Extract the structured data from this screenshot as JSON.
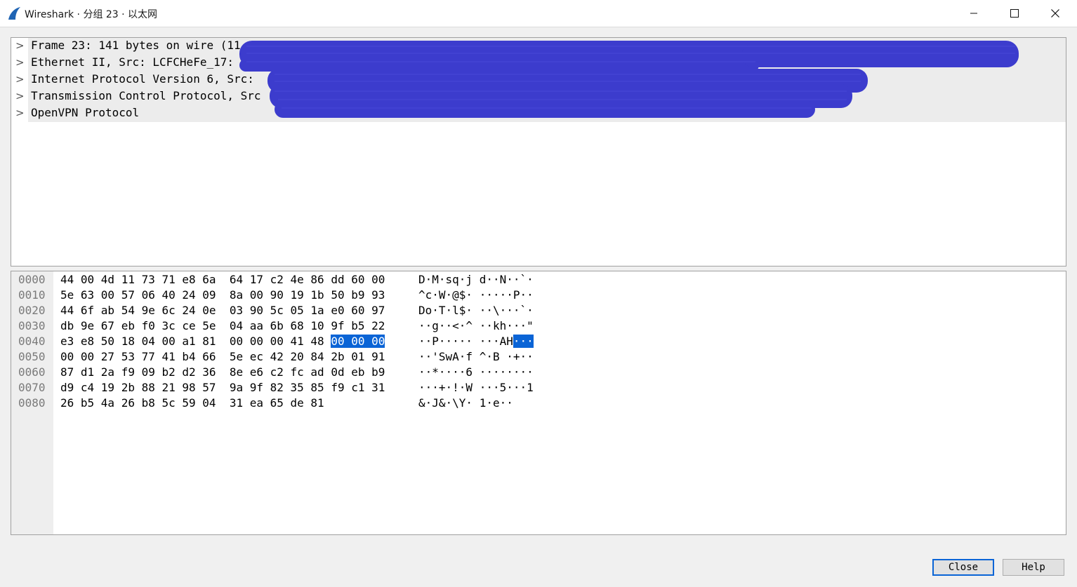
{
  "window": {
    "title": "Wireshark · 分组 23 · 以太网",
    "controls": {
      "minimize_icon": "minimize-icon",
      "maximize_icon": "maximize-icon",
      "close_icon": "close-icon"
    }
  },
  "tree": [
    {
      "label": "Frame 23: 141 bytes on wire (11",
      "expand_icon": "chevron-right-icon"
    },
    {
      "label": "Ethernet II, Src: LCFCHeFe_17:",
      "expand_icon": "chevron-right-icon"
    },
    {
      "label": "Internet Protocol Version 6, Src:",
      "expand_icon": "chevron-right-icon"
    },
    {
      "label": "Transmission Control Protocol, Src",
      "expand_icon": "chevron-right-icon"
    },
    {
      "label": "OpenVPN Protocol",
      "expand_icon": "chevron-right-icon"
    }
  ],
  "redaction_color": "#3333cc",
  "selection_color": "#0a64d6",
  "hex_rows": [
    {
      "offset": "0000",
      "bytes_pre": "44 00 4d 11 73 71 e8 6a  64 17 c2 4e 86 dd 60 00",
      "bytes_sel": "",
      "bytes_post": "",
      "ascii_pre": "D·M·sq·j d··N··`·",
      "ascii_sel": "",
      "ascii_post": ""
    },
    {
      "offset": "0010",
      "bytes_pre": "5e 63 00 57 06 40 24 09  8a 00 90 19 1b 50 b9 93",
      "bytes_sel": "",
      "bytes_post": "",
      "ascii_pre": "^c·W·@$· ·····P··",
      "ascii_sel": "",
      "ascii_post": ""
    },
    {
      "offset": "0020",
      "bytes_pre": "44 6f ab 54 9e 6c 24 0e  03 90 5c 05 1a e0 60 97",
      "bytes_sel": "",
      "bytes_post": "",
      "ascii_pre": "Do·T·l$· ··\\···`·",
      "ascii_sel": "",
      "ascii_post": ""
    },
    {
      "offset": "0030",
      "bytes_pre": "db 9e 67 eb f0 3c ce 5e  04 aa 6b 68 10 9f b5 22",
      "bytes_sel": "",
      "bytes_post": "",
      "ascii_pre": "··g··<·^ ··kh···\"",
      "ascii_sel": "",
      "ascii_post": ""
    },
    {
      "offset": "0040",
      "bytes_pre": "e3 e8 50 18 04 00 a1 81  00 00 00 41 48 ",
      "bytes_sel": "00 00 00",
      "bytes_post": "",
      "ascii_pre": "··P····· ···AH",
      "ascii_sel": "···",
      "ascii_post": ""
    },
    {
      "offset": "0050",
      "bytes_pre": "00 00 27 53 77 41 b4 66  5e ec 42 20 84 2b 01 91",
      "bytes_sel": "",
      "bytes_post": "",
      "ascii_pre": "··'SwA·f ^·B ·+··",
      "ascii_sel": "",
      "ascii_post": ""
    },
    {
      "offset": "0060",
      "bytes_pre": "87 d1 2a f9 09 b2 d2 36  8e e6 c2 fc ad 0d eb b9",
      "bytes_sel": "",
      "bytes_post": "",
      "ascii_pre": "··*····6 ········",
      "ascii_sel": "",
      "ascii_post": ""
    },
    {
      "offset": "0070",
      "bytes_pre": "d9 c4 19 2b 88 21 98 57  9a 9f 82 35 85 f9 c1 31",
      "bytes_sel": "",
      "bytes_post": "",
      "ascii_pre": "···+·!·W ···5···1",
      "ascii_sel": "",
      "ascii_post": ""
    },
    {
      "offset": "0080",
      "bytes_pre": "26 b5 4a 26 b8 5c 59 04  31 ea 65 de 81",
      "bytes_sel": "",
      "bytes_post": "",
      "ascii_pre": "&·J&·\\Y· 1·e··",
      "ascii_sel": "",
      "ascii_post": ""
    }
  ],
  "buttons": {
    "close": "Close",
    "help": "Help"
  }
}
